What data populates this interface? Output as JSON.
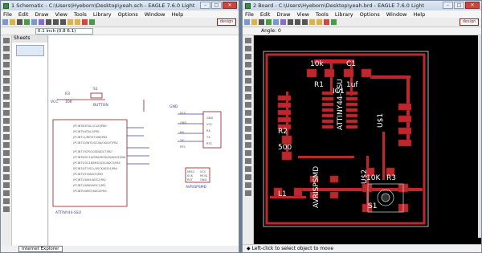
{
  "left": {
    "title": "1 Schematic - C:\\Users\\Hyeborn\\Desktop\\yeah.sch - EAGLE 7.6.0 Light",
    "menus": [
      "File",
      "Edit",
      "Draw",
      "View",
      "Tools",
      "Library",
      "Options",
      "Window",
      "Help"
    ],
    "coord": "0.1 inch (0.8 6.1)",
    "sheets_label": "Sheets",
    "tooltip": "Internet Explorer",
    "labels": {
      "vcc": "VCC",
      "r3": "R3",
      "r3v": "10K",
      "s1": "S1",
      "button": "BUTTON",
      "gnd": "GND",
      "attiny": "ATTINY44-SSU",
      "avrisp": "AVRISPSMD",
      "pins": [
        "(PCINT8/XTAL1/CLKI)PB0",
        "(PCINT9/XTAL2)PB1",
        "(PCINT11/RESET/dW)PB3",
        "(PCINT10/INT0/OC0A/CKOUT)PB2",
        "(PCINT7/ICP/OC0B/ADC7)PA7",
        "(PCINT6/OC1A/SDA/MOSI/DI/ADC6)PA6",
        "(PCINT5/OC1B/MISO/DO/ADC5)PA5",
        "(PCINT4/T1/SCL/USCK/ADC4)PA4",
        "(PCINT3/T0/ADC3)PA3",
        "(PCINT2/AIN1/ADC2)PA2",
        "(PCINT1/AIN0/ADC1)PA1",
        "(PCINT0/AREF/ADC0)PA0"
      ],
      "right_pins": [
        "GND",
        "VCC",
        "RX",
        "TX",
        "RTS"
      ],
      "avr_pins": [
        "MISO",
        "SCK",
        "RST",
        "VCC",
        "MOSI",
        "GND"
      ],
      "mid": [
        "VCC",
        "GND",
        "RX",
        "TX",
        "RTS"
      ]
    }
  },
  "right": {
    "title": "2 Board - C:\\Users\\Hyeborn\\Desktop\\yeah.brd - EAGLE 7.6.0 Light",
    "menus": [
      "File",
      "Edit",
      "Draw",
      "View",
      "Tools",
      "Library",
      "Options",
      "Window",
      "Help"
    ],
    "layer_label": "Angle: 0",
    "coord": "0.1 inch (0.86 1.15)",
    "status": "◆ Left-click to select object to move",
    "board_labels": {
      "r1v": "10k",
      "r1": "R1",
      "c1": "C1",
      "c1v": "1uf",
      "ic1": "IC1",
      "attiny": "ATTINY44-SSU",
      "r2": "R2",
      "r2v": "500",
      "u1": "U$1",
      "avrisp": "AVRISPSMD",
      "l1": "L1",
      "r3v": "10K",
      "r3": "R3",
      "u2": "U$2",
      "s1": "S1"
    }
  },
  "colors": {
    "trace": "#c0272d",
    "pad": "#c0272d",
    "label": "#ffffff",
    "wire": "#3f3f9a",
    "part": "#8a1b1b"
  }
}
